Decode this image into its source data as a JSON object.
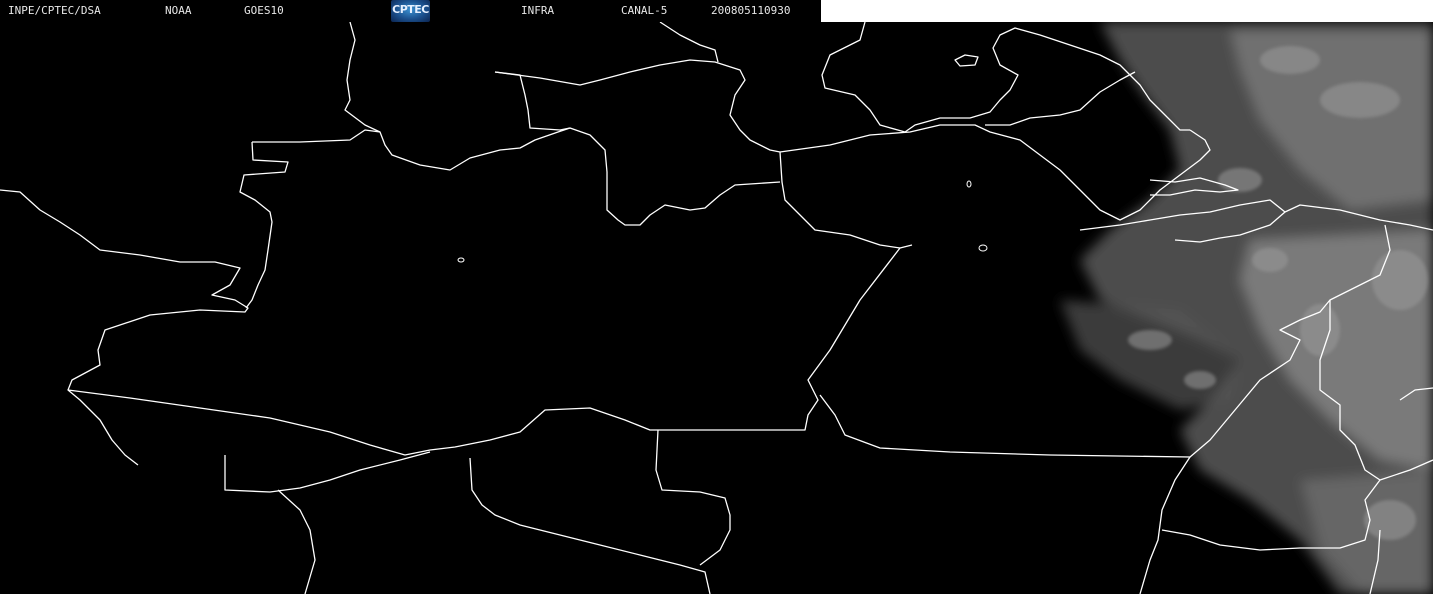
{
  "header": {
    "source": "INPE/CPTEC/DSA",
    "agency": "NOAA",
    "satellite": "GOES10",
    "logo_text": "CPTEC",
    "product": "INFRA",
    "channel": "CANAL-5",
    "timestamp": "200805110930"
  },
  "colors": {
    "background": "#000000",
    "borders": "#ffffff",
    "header_text": "#e8e8e8",
    "header_blank": "#ffffff",
    "cloud_gray": "#8a8a8a"
  }
}
